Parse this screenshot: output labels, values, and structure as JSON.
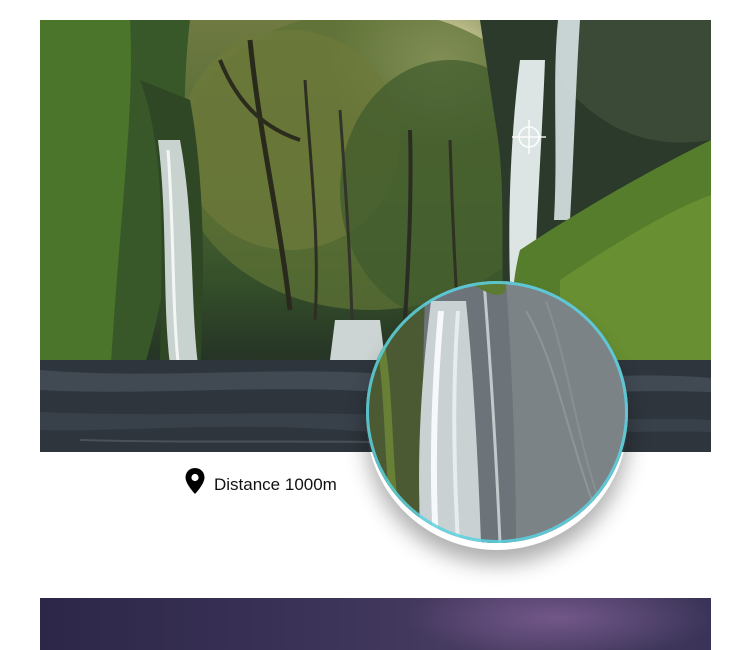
{
  "scene": {
    "subject": "forest-waterfall-photo",
    "accent_color": "#45c8d6"
  },
  "lens": {
    "subject": "magnified-waterfall"
  },
  "crosshair": {
    "icon": "crosshair-icon"
  },
  "distance": {
    "icon": "location-pin-icon",
    "label": "Distance 1000m"
  },
  "night_image": {
    "subject": "night-sky-photo"
  }
}
